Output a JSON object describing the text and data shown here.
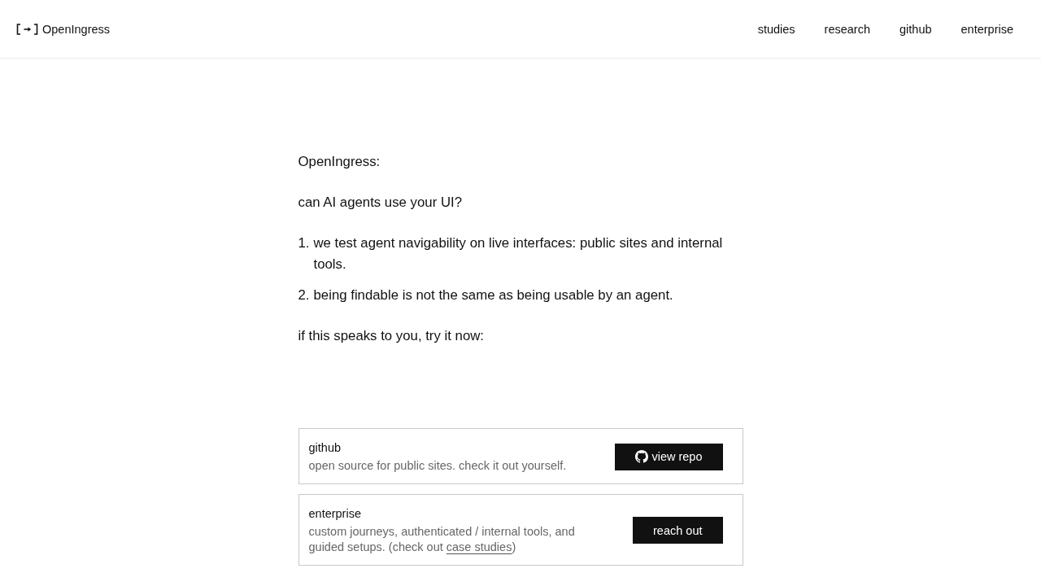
{
  "header": {
    "logo": "OpenIngress",
    "nav": [
      "studies",
      "research",
      "github",
      "enterprise"
    ]
  },
  "main": {
    "title": "OpenIngress:",
    "question": "can AI agents use your UI?",
    "points": [
      {
        "number": "1.",
        "text": "we test agent navigability on live interfaces: public sites and internal tools."
      },
      {
        "number": "2.",
        "text": "being findable is not the same as being usable by an agent."
      }
    ],
    "call_to_action": "if this speaks to you, try it now:"
  },
  "cards": [
    {
      "kind": "repo",
      "title": "github",
      "description": "open source for public sites. check it out yourself.",
      "button": "view repo"
    },
    {
      "kind": "contact",
      "title": "enterprise",
      "description": "custom journeys, authenticated / internal tools, and guided setups. (check out ",
      "link": "case studies",
      "description_end": ")",
      "button": "reach out"
    }
  ]
}
